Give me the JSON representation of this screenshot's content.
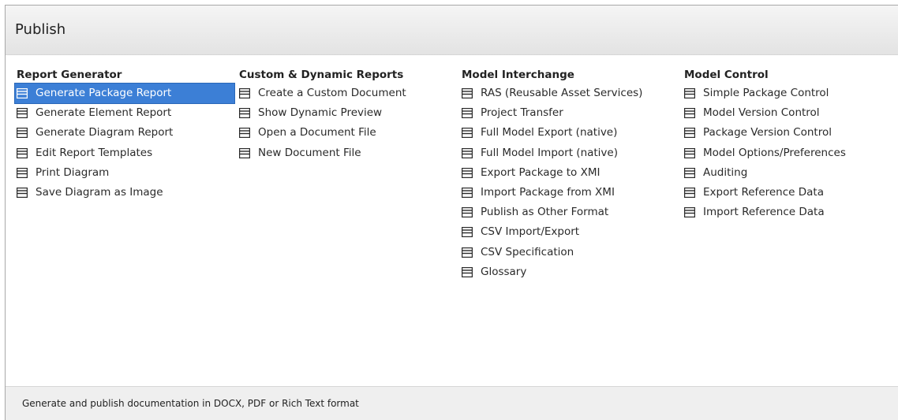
{
  "header": {
    "title": "Publish"
  },
  "columns": [
    {
      "heading": "Report Generator",
      "items": [
        {
          "label": "Generate Package Report",
          "selected": true
        },
        {
          "label": "Generate Element Report"
        },
        {
          "label": "Generate Diagram Report"
        },
        {
          "label": "Edit Report Templates"
        },
        {
          "label": "Print Diagram"
        },
        {
          "label": "Save Diagram as Image"
        }
      ]
    },
    {
      "heading": "Custom & Dynamic Reports",
      "items": [
        {
          "label": "Create a Custom Document"
        },
        {
          "label": "Show Dynamic Preview"
        },
        {
          "label": "Open a Document File"
        },
        {
          "label": "New Document File"
        }
      ]
    },
    {
      "heading": "Model Interchange",
      "items": [
        {
          "label": "RAS (Reusable Asset Services)"
        },
        {
          "label": "Project Transfer"
        },
        {
          "label": "Full Model Export (native)"
        },
        {
          "label": "Full Model Import (native)"
        },
        {
          "label": "Export Package to XMI"
        },
        {
          "label": "Import Package from XMI"
        },
        {
          "label": "Publish as Other Format"
        },
        {
          "label": "CSV Import/Export"
        },
        {
          "label": "CSV Specification"
        },
        {
          "label": "Glossary"
        }
      ]
    },
    {
      "heading": "Model Control",
      "items": [
        {
          "label": "Simple Package Control"
        },
        {
          "label": "Model Version Control"
        },
        {
          "label": "Package Version Control"
        },
        {
          "label": "Model Options/Preferences"
        },
        {
          "label": "Auditing"
        },
        {
          "label": "Export Reference Data"
        },
        {
          "label": "Import Reference Data"
        }
      ]
    }
  ],
  "item_icon": "window-icon",
  "colors": {
    "selection": "#3c7fd6",
    "header_bg": "#e8e8e8",
    "footer_bg": "#efefef"
  },
  "footer": {
    "status": "Generate and publish documentation in DOCX, PDF or Rich Text format"
  }
}
